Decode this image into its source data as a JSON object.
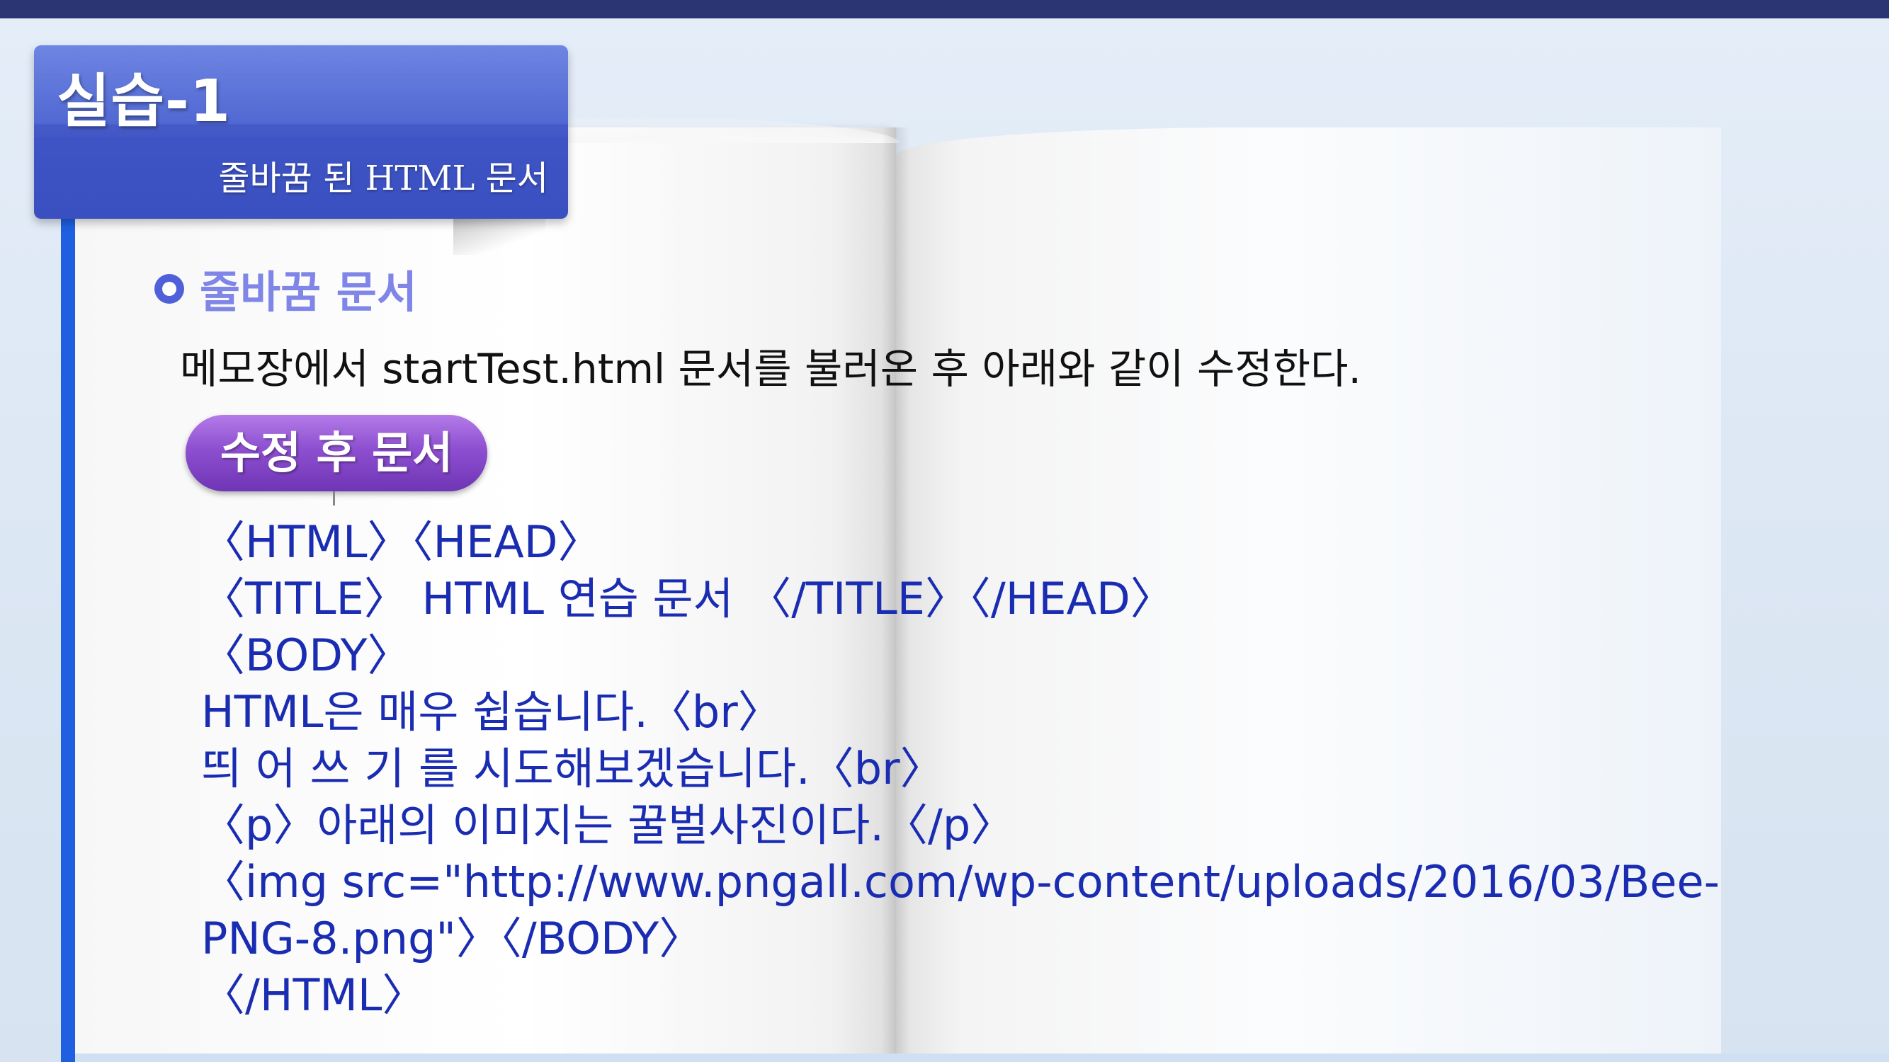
{
  "header": {
    "title": "실습-1",
    "subtitle": "줄바꿈 된 HTML 문서"
  },
  "section": {
    "heading": "줄바꿈 문서",
    "instruction": "메모장에서 startTest.html 문서를 불러온 후 아래와 같이 수정한다."
  },
  "badge": {
    "label": "수정 후 문서"
  },
  "code_lines": [
    "〈HTML〉〈HEAD〉",
    "〈TITLE〉 HTML 연습 문서 〈/TITLE〉〈/HEAD〉",
    "〈BODY〉",
    "HTML은 매우 쉽습니다.〈br〉",
    "띄 어 쓰 기 를 시도해보겠습니다.〈br〉",
    "〈p〉아래의 이미지는 꿀벌사진이다.〈/p〉",
    "〈img src=\"http://www.pngall.com/wp-content/uploads/2016/03/Bee-",
    "PNG-8.png\"〉〈/BODY〉",
    "〈/HTML〉"
  ],
  "colors": {
    "top_bar": "#2c3573",
    "tab": "#4a63d1",
    "accent_line": "#1f5fe0",
    "heading": "#7f86e8",
    "pill": "#8d4fd0",
    "code_text": "#1a2cb2"
  },
  "icons": {
    "bullet": "ring-bullet-icon"
  }
}
